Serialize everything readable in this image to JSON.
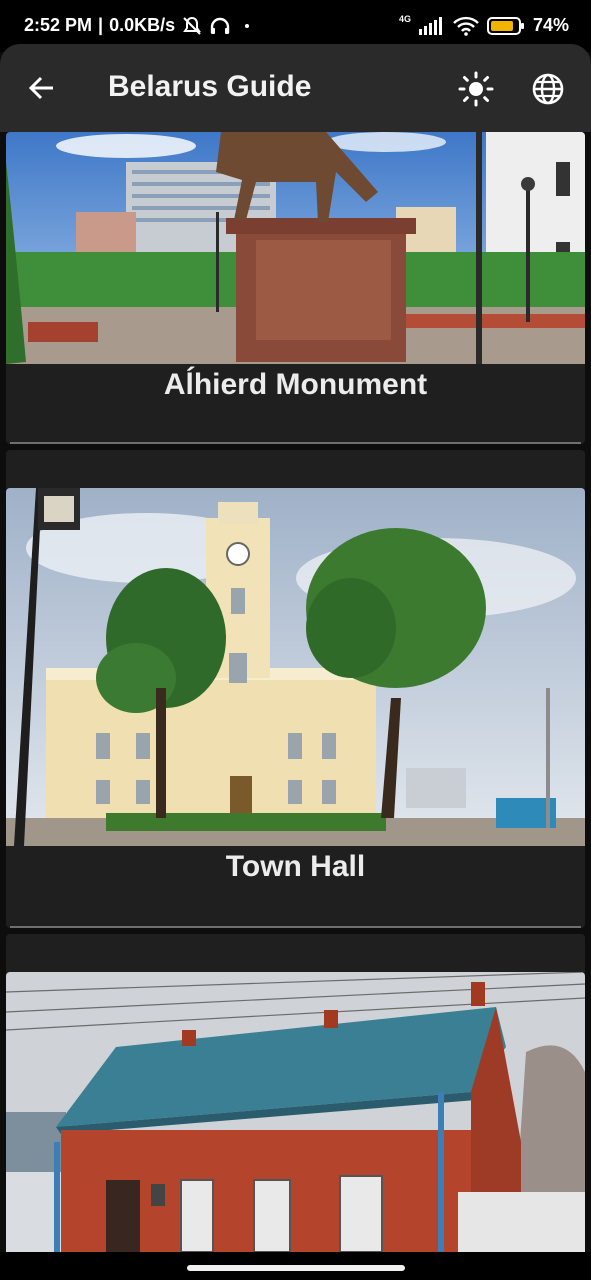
{
  "status": {
    "time": "2:52 PM",
    "speed": "0.0KB/s",
    "network": "4G",
    "battery": "74%"
  },
  "appbar": {
    "title": "Belarus Guide",
    "back_icon": "arrow-left-icon",
    "theme_icon": "sun-icon",
    "language_icon": "globe-icon"
  },
  "places": [
    {
      "name": "Alhierd Monument",
      "label": "Aĺhierd Monument"
    },
    {
      "name": "Town Hall",
      "label": "Town Hall"
    },
    {
      "name": "Red Brick House",
      "label": ""
    }
  ]
}
